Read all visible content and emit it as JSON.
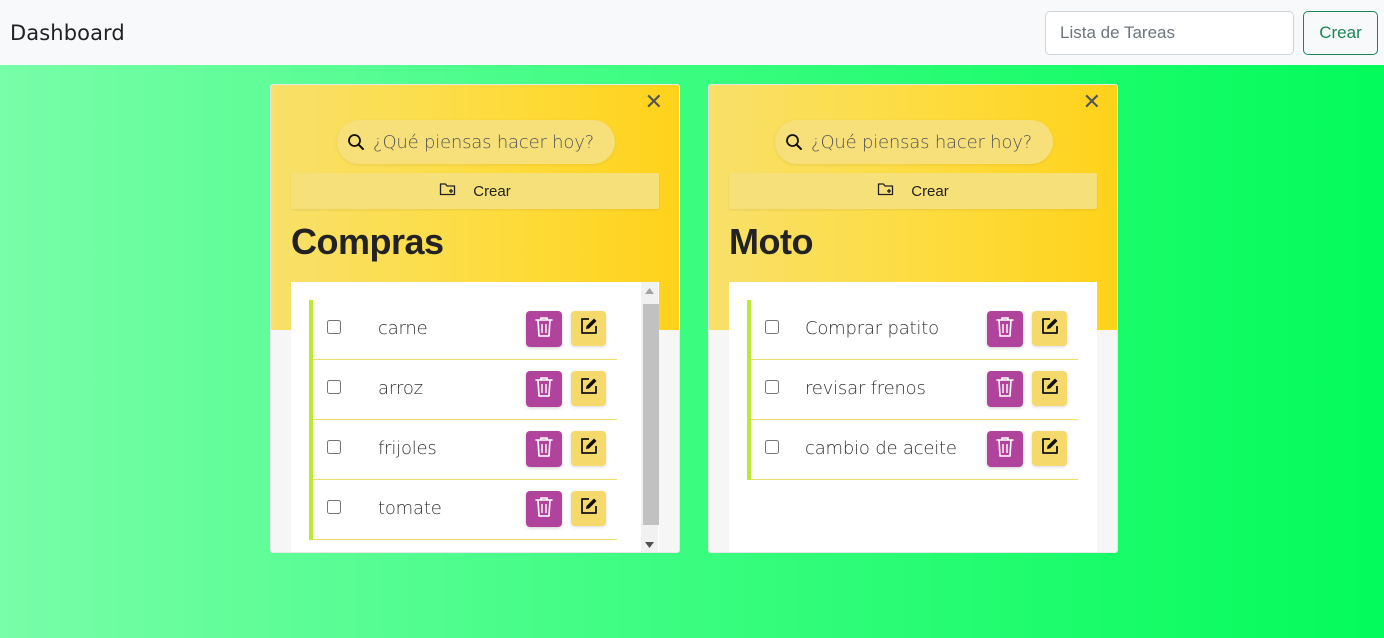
{
  "navbar": {
    "brand": "Dashboard",
    "input_placeholder": "Lista de Tareas",
    "create_label": "Crear"
  },
  "cards": [
    {
      "title": "Compras",
      "search_placeholder": "¿Qué piensas hacer hoy?",
      "create_label": "Crear",
      "close_glyph": "✕",
      "tasks": [
        {
          "text": "carne",
          "checked": false
        },
        {
          "text": "arroz",
          "checked": false
        },
        {
          "text": "frijoles",
          "checked": false
        },
        {
          "text": "tomate",
          "checked": false
        }
      ]
    },
    {
      "title": "Moto",
      "search_placeholder": "¿Qué piensas hacer hoy?",
      "create_label": "Crear",
      "close_glyph": "✕",
      "tasks": [
        {
          "text": "Comprar patito",
          "checked": false
        },
        {
          "text": "revisar frenos",
          "checked": false
        },
        {
          "text": "cambio de aceite",
          "checked": false
        }
      ]
    }
  ],
  "colors": {
    "card_header": "#fedb3a",
    "delete_button": "#b0449c",
    "edit_button": "#f5d96a",
    "list_accent": "#bce935",
    "nav_button": "#198754"
  },
  "icons": {
    "search": "search-icon",
    "create": "folder-plus-icon",
    "delete": "trash-icon",
    "edit": "edit-icon",
    "close": "close-icon"
  }
}
